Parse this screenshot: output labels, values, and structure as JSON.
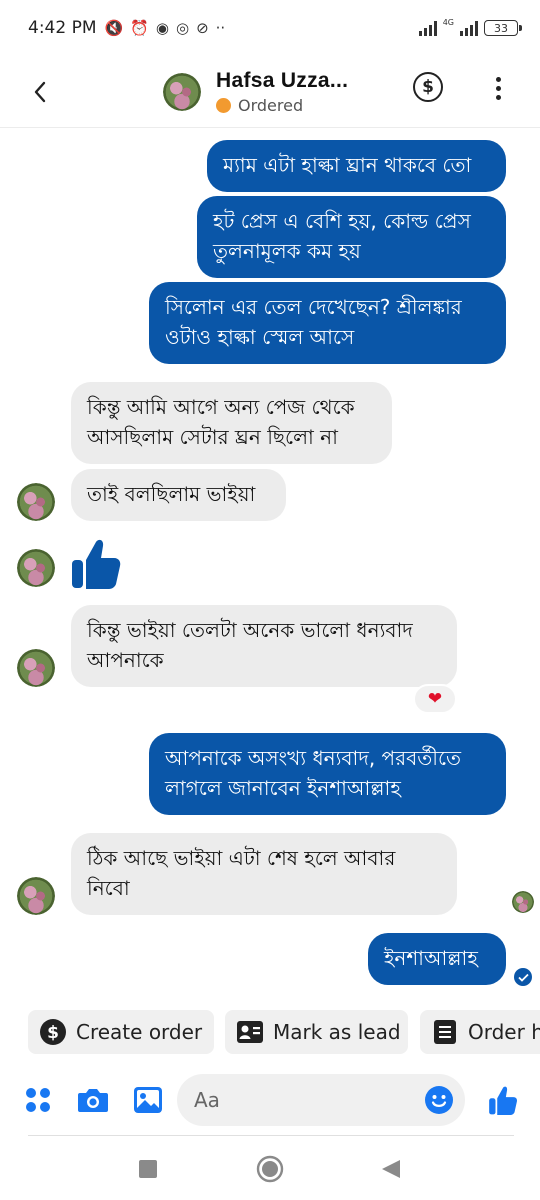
{
  "status_bar": {
    "time": "4:42 PM",
    "network_label": "4G",
    "battery": "33"
  },
  "header": {
    "contact_name": "Hafsa Uzza...",
    "contact_status": "Ordered",
    "status_color": "#f29a30"
  },
  "messages": [
    {
      "side": "out",
      "text_lines": [
        "ম্যাম এটা হাল্কা ঘ্রান থাকবে তো"
      ]
    },
    {
      "side": "out",
      "text_lines": [
        "হট প্রেস এ বেশি হয়, কোল্ড প্রেস",
        "তুলনামূলক কম হয়"
      ]
    },
    {
      "side": "out",
      "text_lines": [
        "সিলোন এর তেল দেখেছেন? শ্রীলঙ্কার",
        "ওটাও হাল্কা স্মেল আসে"
      ]
    },
    {
      "side": "in",
      "text_lines": [
        "কিন্তু আমি আগে অন্য পেজ থেকে",
        "আসছিলাম সেটার ঘ্রন ছিলো না"
      ]
    },
    {
      "side": "in",
      "text_lines": [
        "তাই বলছিলাম ভাইয়া"
      ]
    },
    {
      "side": "in",
      "type": "thumbs-up"
    },
    {
      "side": "in",
      "text_lines": [
        "কিন্তু ভাইয়া তেলটা অনেক ভালো ধন্যবাদ",
        "আপনাকে"
      ],
      "reaction": "❤"
    },
    {
      "side": "out",
      "text_lines": [
        "আপনাকে অসংখ্য ধন্যবাদ, পরবর্তীতে",
        "লাগলে জানাবেন ইনশাআল্লাহ"
      ]
    },
    {
      "side": "in",
      "text_lines": [
        "ঠিক আছে ভাইয়া এটা শেষ হলে আবার",
        "নিবো"
      ]
    },
    {
      "side": "out",
      "text_lines": [
        "ইনশাআল্লাহ"
      ]
    }
  ],
  "quick_actions": [
    {
      "label": "Create order",
      "icon": "dollar-circle-icon"
    },
    {
      "label": "Mark as lead",
      "icon": "contact-card-icon"
    },
    {
      "label": "Order h",
      "icon": "order-history-icon"
    }
  ],
  "composer": {
    "placeholder": "Aa"
  },
  "colors": {
    "accent": "#1877f2",
    "outgoing_bubble": "#0a56a8",
    "incoming_bubble": "#ececec"
  }
}
